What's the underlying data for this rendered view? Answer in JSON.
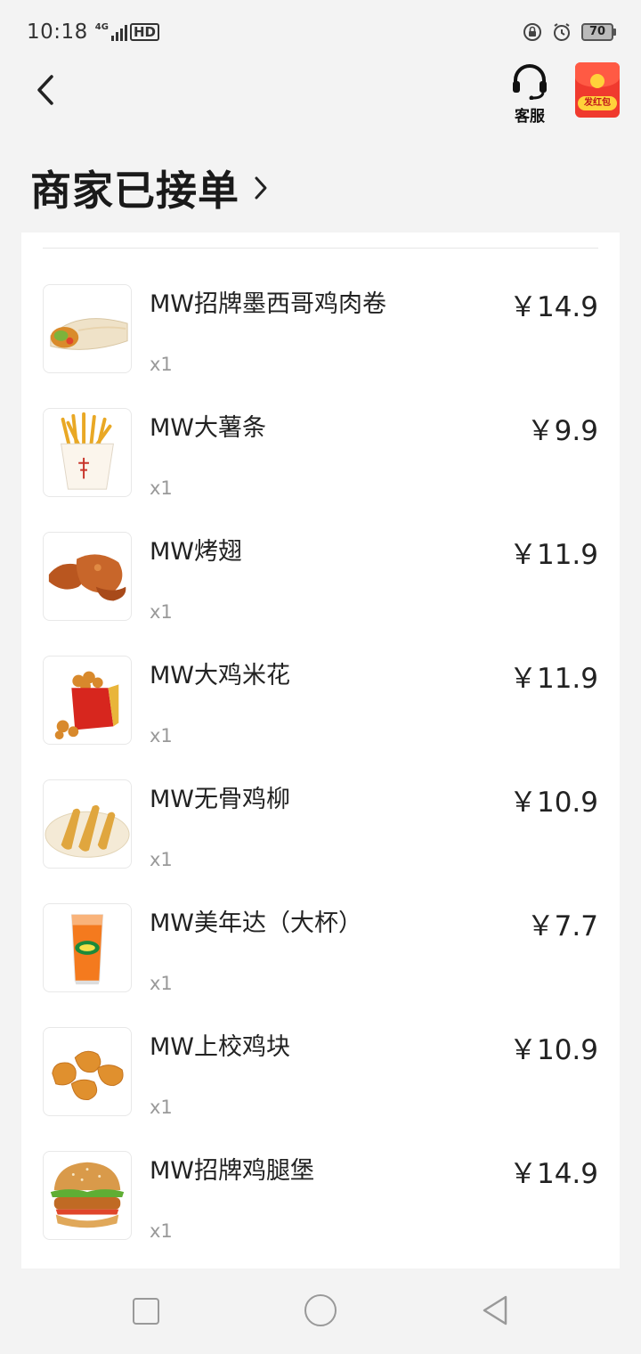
{
  "status_bar": {
    "time": "10:18",
    "network": "4G",
    "hd": "HD",
    "battery": "70"
  },
  "nav": {
    "service_label": "客服",
    "redpacket_label": "发红包"
  },
  "order": {
    "status_title": "商家已接单"
  },
  "items": [
    {
      "name": "MW招牌墨西哥鸡肉卷",
      "qty": "x1",
      "price": "￥14.9",
      "icon": "wrap-image"
    },
    {
      "name": "MW大薯条",
      "qty": "x1",
      "price": "￥9.9",
      "icon": "fries-image"
    },
    {
      "name": "MW烤翅",
      "qty": "x1",
      "price": "￥11.9",
      "icon": "wings-image"
    },
    {
      "name": "MW大鸡米花",
      "qty": "x1",
      "price": "￥11.9",
      "icon": "popcorn-chicken-image"
    },
    {
      "name": "MW无骨鸡柳",
      "qty": "x1",
      "price": "￥10.9",
      "icon": "chicken-strips-image"
    },
    {
      "name": "MW美年达（大杯）",
      "qty": "x1",
      "price": "￥7.7",
      "icon": "mirinda-cup-image"
    },
    {
      "name": "MW上校鸡块",
      "qty": "x1",
      "price": "￥10.9",
      "icon": "nuggets-image"
    },
    {
      "name": "MW招牌鸡腿堡",
      "qty": "x1",
      "price": "￥14.9",
      "icon": "burger-image"
    }
  ],
  "colors": {
    "background": "#f3f3f3",
    "card": "#ffffff",
    "redpacket": "#f03a2e",
    "text_primary": "#222222",
    "text_secondary": "#999999"
  }
}
